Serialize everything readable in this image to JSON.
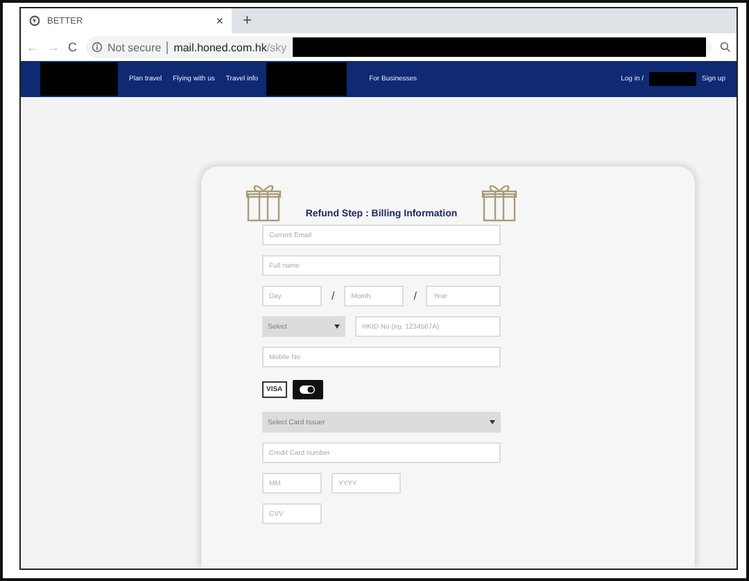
{
  "browser": {
    "tab_title": "BETTER",
    "tab_close": "×",
    "new_tab": "+",
    "back": "←",
    "forward": "→",
    "reload": "C",
    "security": "Not secure",
    "url_host": "mail.honed.com.hk",
    "url_path": "/sky"
  },
  "nav": {
    "links": [
      "Plan travel",
      "Flying with us",
      "Travel info"
    ],
    "links_after": [
      "For Businesses"
    ],
    "login": "Log in /",
    "signup": "Sign up"
  },
  "form": {
    "title": "Refund Step : Billing Information",
    "email": {
      "placeholder": "Current Email"
    },
    "full_name": {
      "placeholder": "Full name"
    },
    "dob": {
      "day": {
        "placeholder": "Day"
      },
      "month": {
        "placeholder": "Month"
      },
      "year": {
        "placeholder": "Year"
      },
      "separator": "/"
    },
    "id_type": {
      "value": "Select"
    },
    "id_number": {
      "placeholder": "HKID No (eg. 1234567A)"
    },
    "mobile": {
      "placeholder": "Mobile No"
    },
    "card_brands": [
      {
        "kind": "visa",
        "label": "VISA"
      },
      {
        "kind": "other"
      }
    ],
    "card_issuer": {
      "value": "Select Card Issuer"
    },
    "card_number": {
      "placeholder": "Credit Card number"
    },
    "expiry_month": {
      "placeholder": "MM"
    },
    "expiry_year": {
      "placeholder": "YYYY"
    },
    "cvv": {
      "placeholder": "CVV"
    }
  }
}
